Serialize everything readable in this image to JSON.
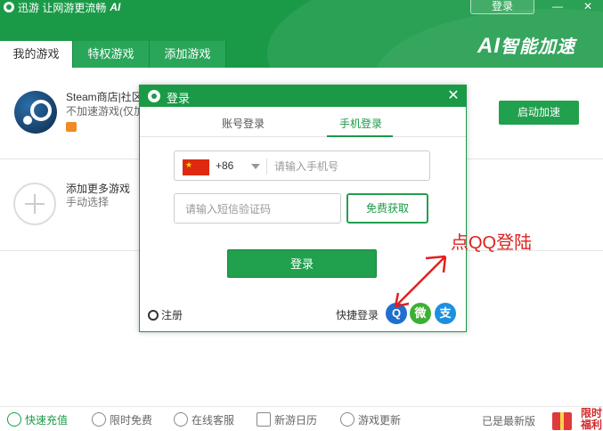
{
  "app": {
    "brand_name": "迅游 让网游更流畅",
    "brand_ai": "AI",
    "login_label": "登录",
    "min_glyph": "—",
    "close_glyph": "✕",
    "header_logo_ai": "AI",
    "header_logo_text": "智能加速"
  },
  "tabs": [
    {
      "label": "我的游戏",
      "active": true
    },
    {
      "label": "特权游戏",
      "active": false
    },
    {
      "label": "添加游戏",
      "active": false
    }
  ],
  "games": [
    {
      "title": "Steam商店|社区",
      "subtitle": "不加速游戏(仅加",
      "action": "启动加速",
      "icon": "steam-icon"
    }
  ],
  "add_game": {
    "title": "添加更多游戏",
    "subtitle": "手动选择",
    "icon": "plus-icon"
  },
  "footer": {
    "items": [
      {
        "label": "快速充值",
        "icon": "recharge-icon"
      },
      {
        "label": "限时免费",
        "icon": "timer-icon"
      },
      {
        "label": "在线客服",
        "icon": "support-icon"
      },
      {
        "label": "新游日历",
        "icon": "calendar-icon"
      },
      {
        "label": "游戏更新",
        "icon": "update-icon"
      }
    ],
    "version_status": "已是最新版",
    "gift_label": "限时福利"
  },
  "dialog": {
    "title": "登录",
    "close_glyph": "✕",
    "tabs": [
      "账号登录",
      "手机登录"
    ],
    "active_tab": "手机登录",
    "country_code": "+86",
    "phone_placeholder": "请输入手机号",
    "sms_placeholder": "请输入短信验证码",
    "sms_button": "免费获取",
    "submit": "登录",
    "register": "注册",
    "quick_login_label": "快捷登录",
    "quick_logins": [
      {
        "name": "qq",
        "glyph": "Q"
      },
      {
        "name": "wechat",
        "glyph": "微"
      },
      {
        "name": "alipay",
        "glyph": "支"
      }
    ]
  },
  "annotation": {
    "text": "点QQ登陆",
    "color": "#e02020"
  },
  "colors": {
    "brand_green": "#1a9a47",
    "accent_red": "#e02020"
  }
}
